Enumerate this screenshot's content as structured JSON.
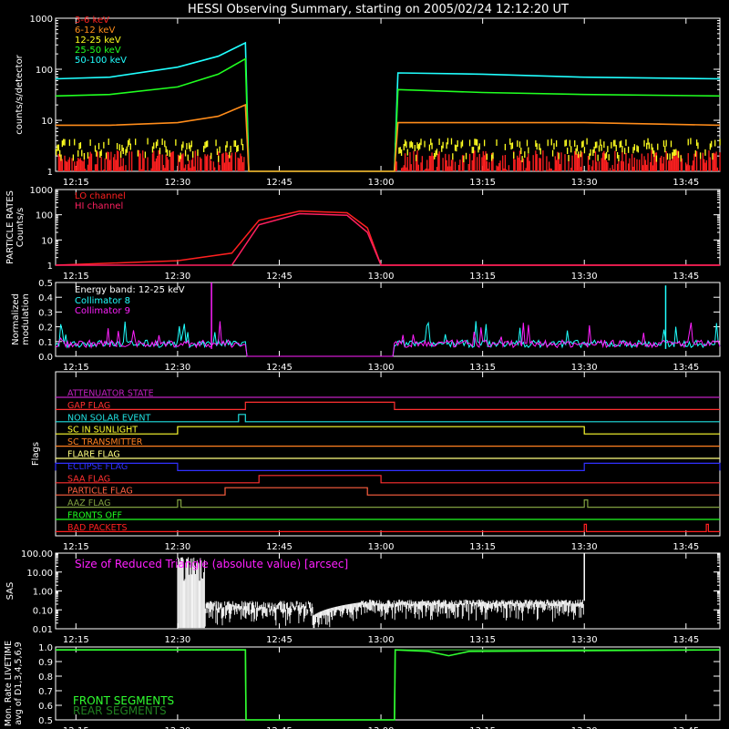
{
  "title": "HESSI Observing Summary, starting on 2005/02/24 12:12:20 UT",
  "time_ticks": [
    "12:15",
    "12:30",
    "12:45",
    "13:00",
    "13:15",
    "13:30",
    "13:45"
  ],
  "chart_data": [
    {
      "type": "line",
      "name_hint": "count rates",
      "ylabel": "counts/s/detector",
      "yscale": "log",
      "ylim": [
        1,
        1000
      ],
      "y_tick_labels": [
        "1",
        "10",
        "100",
        "1000"
      ],
      "legend_placement": "top-left",
      "series": [
        {
          "name": "3-6 keV",
          "color": "#ff2020"
        },
        {
          "name": "6-12 keV",
          "color": "#ff8c1a"
        },
        {
          "name": "12-25 keV",
          "color": "#ffff20"
        },
        {
          "name": "25-50 keV",
          "color": "#20ff20"
        },
        {
          "name": "50-100 keV",
          "color": "#20ffff"
        }
      ],
      "x": [
        "12:12",
        "12:20",
        "12:30",
        "12:36",
        "12:40",
        "12:40.5",
        "13:02",
        "13:02.5",
        "13:15",
        "13:30",
        "13:50"
      ],
      "values_by_series": {
        "50-100 keV": [
          65,
          70,
          110,
          180,
          330,
          1,
          1,
          85,
          80,
          70,
          65
        ],
        "25-50 keV": [
          30,
          32,
          45,
          80,
          160,
          1,
          1,
          40,
          35,
          32,
          30
        ],
        "6-12 keV": [
          8,
          8,
          9,
          12,
          20,
          1,
          1,
          9,
          9,
          9,
          8
        ]
      }
    },
    {
      "type": "line",
      "ylabel": "PARTICLE RATES Counts/s",
      "yscale": "log",
      "ylim": [
        1,
        1000
      ],
      "y_tick_labels": [
        "1",
        "10",
        "100",
        "1000"
      ],
      "legend_placement": "top-left",
      "series": [
        {
          "name": "LO channel",
          "color": "#ff2020",
          "x": [
            "12:12",
            "12:30",
            "12:38",
            "12:42",
            "12:48",
            "12:55",
            "12:58",
            "13:00",
            "13:50"
          ],
          "values": [
            1,
            1.5,
            3,
            60,
            140,
            120,
            30,
            1,
            1
          ]
        },
        {
          "name": "HI channel",
          "color": "#ff2060",
          "x": [
            "12:12",
            "12:38",
            "12:42",
            "12:48",
            "12:55",
            "12:58",
            "13:00",
            "13:50"
          ],
          "values": [
            1,
            1,
            40,
            110,
            95,
            20,
            1,
            1
          ]
        }
      ]
    },
    {
      "type": "line",
      "ylabel": "Normalized modulation",
      "ylim": [
        0,
        0.5
      ],
      "y_tick_labels": [
        "0.0",
        "0.1",
        "0.2",
        "0.3",
        "0.4",
        "0.5"
      ],
      "annotation": "Energy band: 12-25 keV",
      "series": [
        {
          "name": "Collimator 8",
          "color": "#20ffff"
        },
        {
          "name": "Collimator 9",
          "color": "#ff20ff"
        }
      ]
    },
    {
      "type": "table",
      "ylabel": "Flags",
      "flags": [
        {
          "name": "ATTENUATOR STATE",
          "color": "#c020c0",
          "on": []
        },
        {
          "name": "GAP FLAG",
          "color": "#ff3030",
          "on": [
            [
              "12:40",
              "13:02"
            ]
          ]
        },
        {
          "name": "NON SOLAR EVENT",
          "color": "#20e0e0",
          "on": [
            [
              "12:39",
              "12:40"
            ]
          ]
        },
        {
          "name": "SC IN SUNLIGHT",
          "color": "#ffff30",
          "on": [
            [
              "12:30",
              "13:30"
            ]
          ]
        },
        {
          "name": "SC TRANSMITTER",
          "color": "#ff8020",
          "on": []
        },
        {
          "name": "FLARE FLAG",
          "color": "#ffff80",
          "on": []
        },
        {
          "name": "ECLIPSE FLAG",
          "color": "#3030ff",
          "on": [
            [
              "12:12",
              "12:30"
            ],
            [
              "13:30",
              "13:50"
            ]
          ]
        },
        {
          "name": "SAA FLAG",
          "color": "#ff3030",
          "on": [
            [
              "12:42",
              "13:00"
            ]
          ]
        },
        {
          "name": "PARTICLE FLAG",
          "color": "#ff6040",
          "on": [
            [
              "12:37",
              "12:58"
            ]
          ]
        },
        {
          "name": "AAZ FLAG",
          "color": "#80a040",
          "on": [
            [
              "12:30",
              "12:30.5"
            ],
            [
              "13:30",
              "13:30.5"
            ]
          ]
        },
        {
          "name": "FRONTS OFF",
          "color": "#20ff20",
          "on": []
        },
        {
          "name": "BAD PACKETS",
          "color": "#ff2020",
          "on": [
            [
              "13:30",
              "13:30.3"
            ],
            [
              "13:48",
              "13:48.3"
            ]
          ]
        }
      ]
    },
    {
      "type": "line",
      "ylabel": "SAS",
      "yscale": "log",
      "ylim": [
        0.01,
        100
      ],
      "y_tick_labels": [
        "0.01",
        "0.10",
        "1.00",
        "10.00",
        "100.00"
      ],
      "annotation": "Size of Reduced Triangle (absolute value) [arcsec]",
      "series": [
        {
          "color": "#ffffff",
          "x": [
            "12:30",
            "12:33",
            "12:40",
            "12:50",
            "12:55",
            "13:00",
            "13:15",
            "13:29",
            "13:30"
          ],
          "values": [
            5,
            1,
            0.2,
            0.12,
            0.05,
            0.3,
            0.3,
            0.3,
            100
          ]
        }
      ]
    },
    {
      "type": "line",
      "ylabel": "Mon. Rate LIVETIME avg of D1,3,4,5,6,9",
      "ylim": [
        0.5,
        1.0
      ],
      "y_tick_labels": [
        "0.5",
        "0.6",
        "0.7",
        "0.8",
        "0.9",
        "1.0"
      ],
      "legend_placement": "bottom-left",
      "series": [
        {
          "name": "FRONT SEGMENTS",
          "color": "#30ff30",
          "x": [
            "12:12",
            "12:40",
            "12:40.1",
            "13:02",
            "13:02.1",
            "13:07",
            "13:10",
            "13:13",
            "13:50"
          ],
          "values": [
            0.98,
            0.98,
            0.5,
            0.5,
            0.98,
            0.97,
            0.94,
            0.97,
            0.98
          ]
        },
        {
          "name": "REAR SEGMENTS",
          "color": "#208020",
          "x": [
            "12:12",
            "12:40",
            "12:40.1",
            "13:02",
            "13:02.1",
            "13:50"
          ],
          "values": [
            0.98,
            0.98,
            0.5,
            0.5,
            0.98,
            0.98
          ]
        }
      ]
    }
  ]
}
